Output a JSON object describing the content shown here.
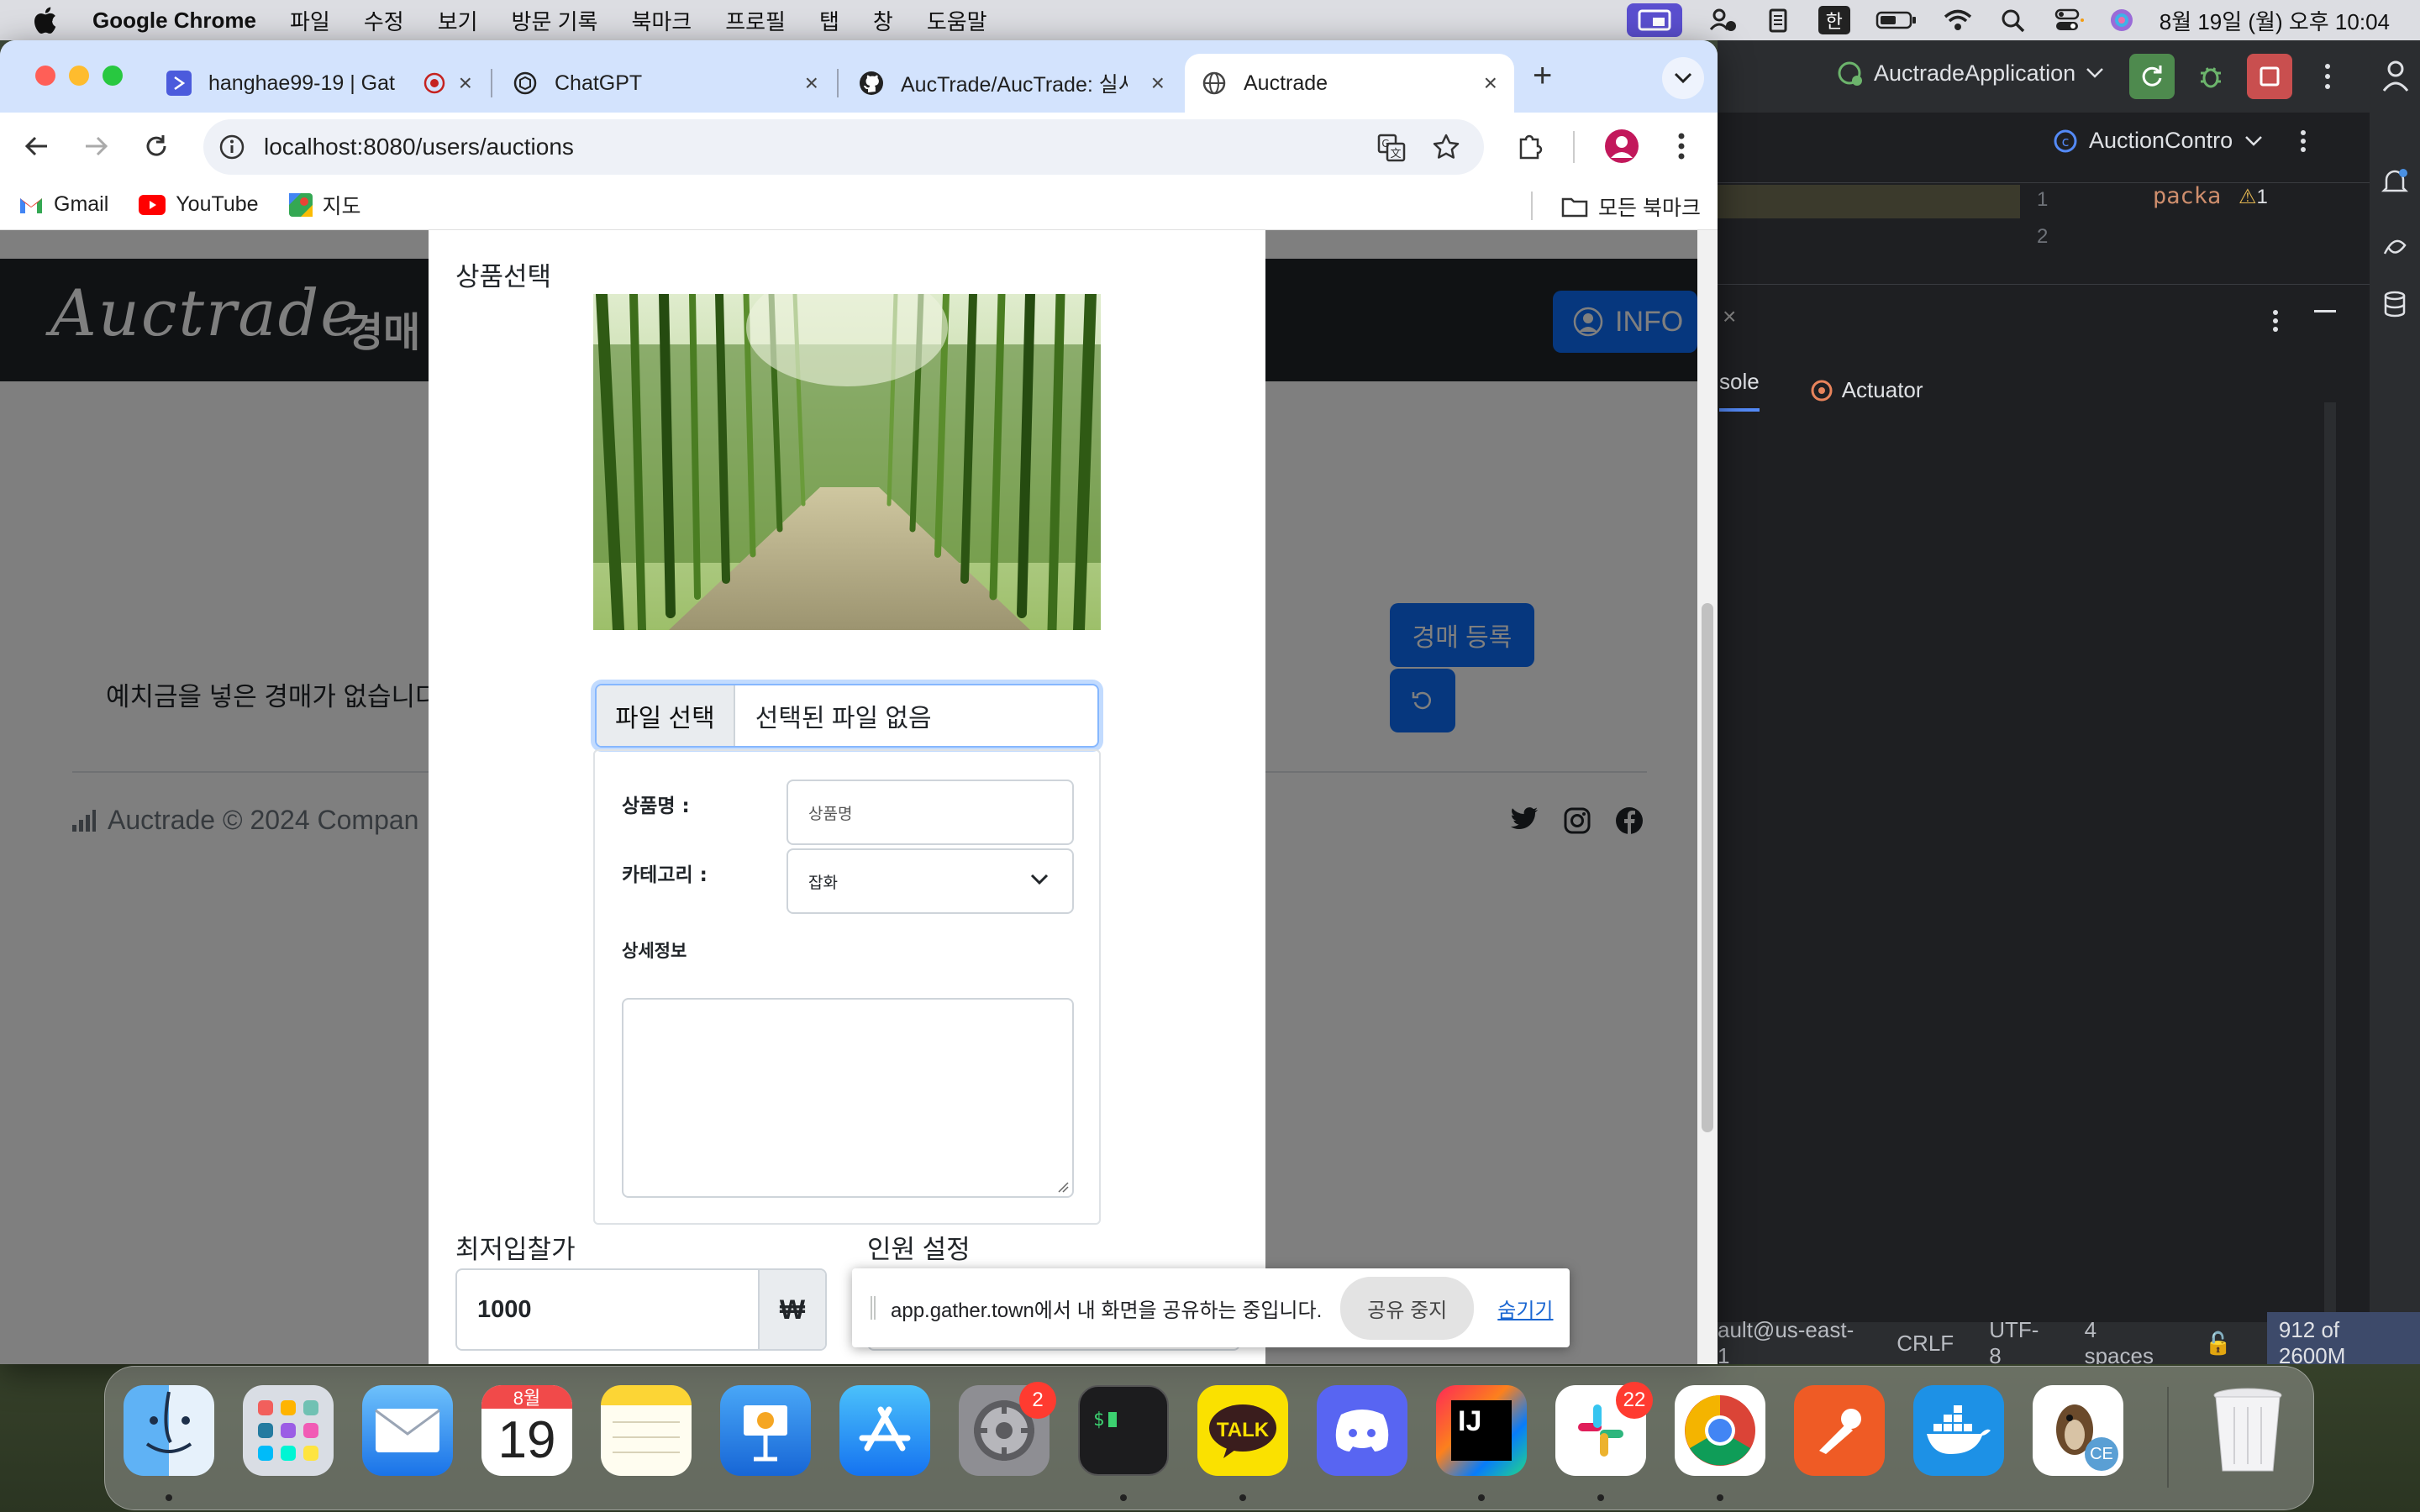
{
  "menubar": {
    "app": "Google Chrome",
    "items": [
      "파일",
      "수정",
      "보기",
      "방문 기록",
      "북마크",
      "프로필",
      "탭",
      "창",
      "도움말"
    ],
    "ime": "한",
    "clock": "8월 19일 (월) 오후 10:04"
  },
  "chrome": {
    "tabs": [
      {
        "title": "hanghae99-19 | Gat",
        "icon": "gather-icon"
      },
      {
        "title": "ChatGPT",
        "icon": "chatgpt-icon"
      },
      {
        "title": "AucTrade/AucTrade: 실시",
        "icon": "github-icon"
      },
      {
        "title": "Auctrade",
        "icon": "globe-icon",
        "active": true
      }
    ],
    "url": "localhost:8080/users/auctions",
    "bookmarks": [
      "Gmail",
      "YouTube",
      "지도"
    ],
    "all_bookmarks": "모든 북마크"
  },
  "site": {
    "logo": "Auctrade",
    "nav": "경매",
    "info_button": "INFO",
    "empty_message": "예치금을 넣은 경매가 없습니다",
    "register_button": "경매 등록",
    "footer": "Auctrade © 2024 Compan"
  },
  "modal": {
    "section_title": "상품선택",
    "file_button": "파일 선택",
    "file_status": "선택된 파일 없음",
    "name_label": "상품명 :",
    "name_placeholder": "상품명",
    "category_label": "카테고리 :",
    "category_value": "잡화",
    "detail_label": "상세정보",
    "min_bid_label": "최저입찰가",
    "min_bid_value": "1000",
    "currency": "₩",
    "people_label": "인원 설정"
  },
  "share_banner": {
    "message": "app.gather.town에서 내 화면을 공유하는 중입니다.",
    "stop_button": "공유 중지",
    "hide_link": "숨기기"
  },
  "ide": {
    "run_config": "AuctradeApplication",
    "editor_tab": "AuctionContro",
    "line_numbers": [
      "1",
      "2"
    ],
    "code": "packa",
    "warning_count": "1",
    "tool_tabs": [
      "sole",
      "Actuator"
    ],
    "status": [
      "ault@us-east-1",
      "CRLF",
      "UTF-8",
      "4 spaces"
    ],
    "memory": "912 of 2600M"
  },
  "dock": {
    "calendar_month": "8월",
    "calendar_day": "19",
    "badges": {
      "settings": "2",
      "slack": "22"
    },
    "intellij_label": "IJ",
    "kakao_label": "TALK",
    "dbeaver_label": "CE",
    "apps": [
      "finder",
      "launchpad",
      "mail",
      "calendar",
      "notes",
      "keynote",
      "app-store",
      "system-settings",
      "terminal",
      "kakaotalk",
      "discord",
      "intellij",
      "slack",
      "chrome",
      "postman",
      "docker",
      "dbeaver",
      "trash"
    ]
  }
}
